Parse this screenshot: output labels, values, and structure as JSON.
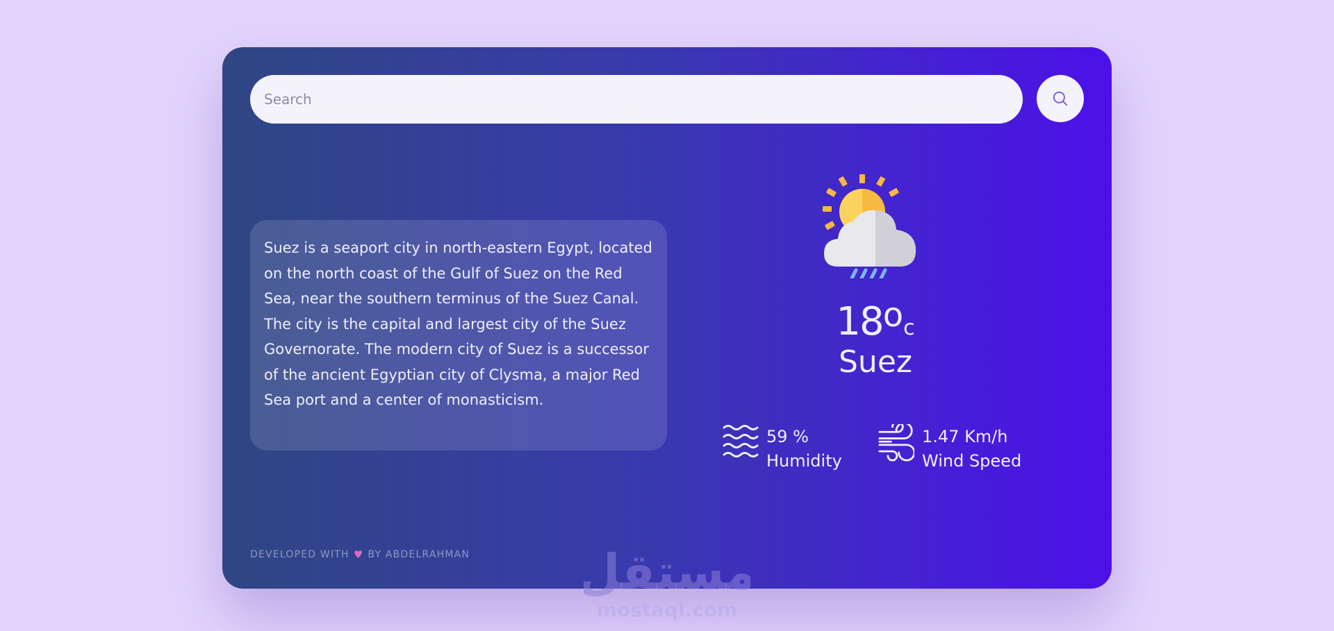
{
  "search": {
    "placeholder": "Search",
    "value": ""
  },
  "description": "Suez is a seaport city in north-eastern Egypt, located on the north coast of the Gulf of Suez on the Red Sea, near the southern terminus of the Suez Canal. The city is the capital and largest city of the Suez Governorate. The modern city of Suez is a successor of the ancient Egyptian city of Clysma, a major Red Sea port and a center of monasticism.",
  "weather": {
    "icon": "sun-cloud-rain-icon",
    "temperature": "18",
    "degree_symbol": "o",
    "unit": "c",
    "city": "Suez"
  },
  "stats": {
    "humidity": {
      "value": "59 %",
      "label": "Humidity",
      "icon": "waves-icon"
    },
    "wind": {
      "value": "1.47 Km/h",
      "label": "Wind Speed",
      "icon": "wind-icon"
    }
  },
  "footer": {
    "prefix": "DEVELOPED WITH",
    "heart": "♥",
    "suffix": "BY ABDELRAHMAN"
  },
  "watermark": {
    "text": "مستقل",
    "subtext": "mostaql.com"
  },
  "colors": {
    "page_background": "#e3d4fd",
    "card_gradient_start": "#2f4682",
    "card_gradient_end": "#4c10e8",
    "input_background": "#f4f3fb",
    "text": "#f1eefc",
    "heart": "#d86ac4"
  }
}
